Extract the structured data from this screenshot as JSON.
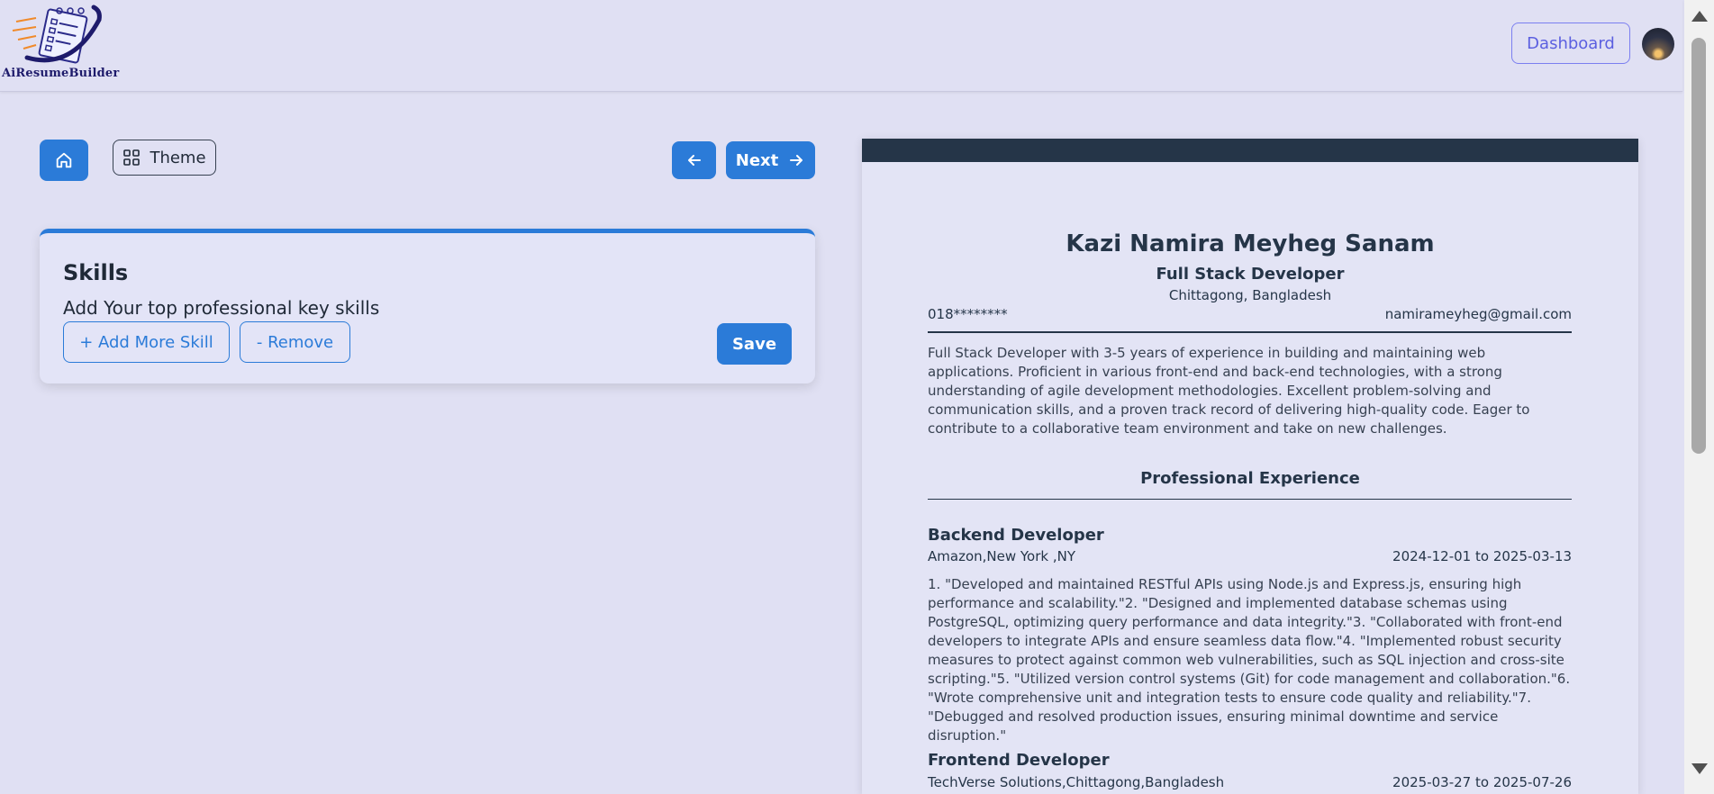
{
  "header": {
    "logo_text": "AiResumeBuilder",
    "dashboard_label": "Dashboard"
  },
  "toolbar": {
    "theme_label": "Theme",
    "next_label": "Next"
  },
  "skills": {
    "title": "Skills",
    "subtitle": "Add Your top professional key skills",
    "add_label": "+ Add More Skill",
    "remove_label": "- Remove",
    "save_label": "Save"
  },
  "resume": {
    "name": "Kazi Namira Meyheg Sanam",
    "job_title": "Full Stack Developer",
    "location": "Chittagong, Bangladesh",
    "phone": "018********",
    "email": "namirameyheg@gmail.com",
    "summary": "Full Stack Developer with 3-5 years of experience in building and maintaining web applications. Proficient in various front-end and back-end technologies, with a strong understanding of agile development methodologies. Excellent problem-solving and communication skills, and a proven track record of delivering high-quality code. Eager to contribute to a collaborative team environment and take on new challenges.",
    "experience_heading": "Professional Experience",
    "experience": [
      {
        "title": "Backend Developer",
        "company": "Amazon,New York ,NY",
        "dates": "2024-12-01 to 2025-03-13",
        "description": "1. \"Developed and maintained RESTful APIs using Node.js and Express.js, ensuring high performance and scalability.\"2.  \"Designed and implemented database schemas using PostgreSQL, optimizing query performance and data integrity.\"3.  \"Collaborated with front-end developers to integrate APIs and ensure seamless data flow.\"4. \"Implemented robust security measures to protect against common web vulnerabilities, such as SQL injection and cross-site scripting.\"5. \"Utilized version control systems (Git) for code management and collaboration.\"6. \"Wrote comprehensive unit and integration tests to ensure code quality and reliability.\"7. \"Debugged and resolved production issues, ensuring minimal downtime and service disruption.\""
      },
      {
        "title": "Frontend Developer",
        "company": "TechVerse Solutions,Chittagong,Bangladesh",
        "dates": "2025-03-27 to 2025-07-26"
      }
    ]
  },
  "icons": {
    "home": "home-icon",
    "theme": "grid-icon",
    "prev": "arrow-left-icon",
    "next": "arrow-right-icon"
  },
  "colors": {
    "accent": "#2b7bd8",
    "dashboard_accent": "#5b5fe0",
    "resume_header_bar": "#253548",
    "background": "#e0e0f3"
  }
}
